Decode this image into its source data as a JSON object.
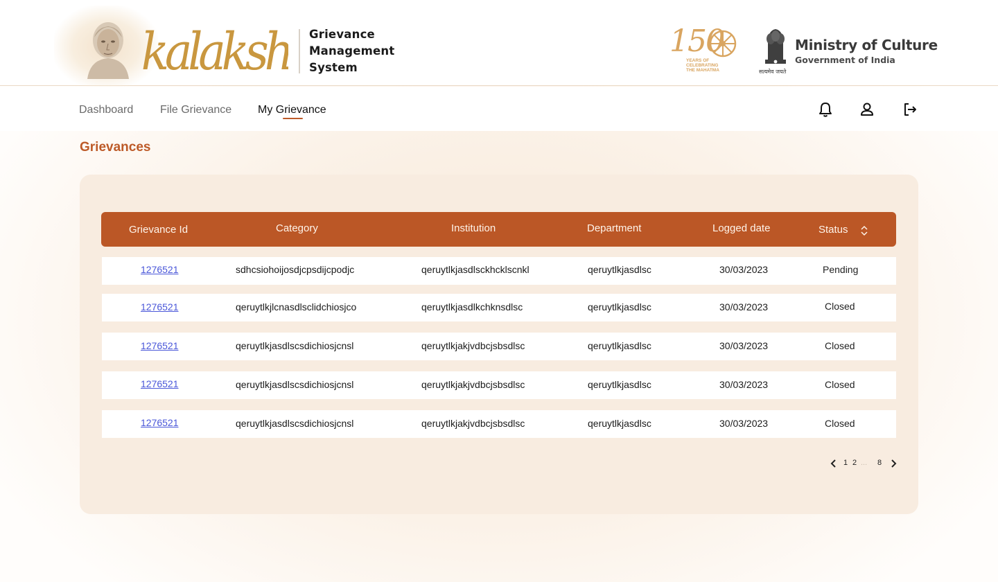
{
  "header": {
    "brand_script": "kalakshetra",
    "system_title_lines": [
      "Grievance",
      "Management",
      "System"
    ],
    "mahatma": {
      "number": "150",
      "subtitle_lines": [
        "YEARS OF",
        "CELEBRATING",
        "THE MAHATMA"
      ]
    },
    "emblem_motto": "सत्यमेव जयते",
    "ministry_name": "Ministry of Culture",
    "ministry_sub": "Government of India"
  },
  "nav": {
    "items": [
      {
        "label": "Dashboard",
        "active": false
      },
      {
        "label": "File Grievance",
        "active": false
      },
      {
        "label": "My Grievance",
        "active": true
      }
    ],
    "icons": [
      "bell-icon",
      "user-icon",
      "logout-icon"
    ]
  },
  "page": {
    "title": "Grievances"
  },
  "table": {
    "columns": [
      "Grievance Id",
      "Category",
      "Institution",
      "Department",
      "Logged date",
      "Status"
    ],
    "rows": [
      {
        "id": "1276521",
        "category": "sdhcsiohoijosdjcpsdijcpodjc",
        "institution": "qeruytlkjasdlsckhcklscnkl",
        "department": "qeruytlkjasdlsc",
        "date": "30/03/2023",
        "status": "Pending"
      },
      {
        "id": "1276521",
        "category": "qeruytlkjlcnasdlsclidchiosjco",
        "institution": "qeruytlkjasdlkchknsdlsc",
        "department": "qeruytlkjasdlsc",
        "date": "30/03/2023",
        "status": "Closed"
      },
      {
        "id": "1276521",
        "category": "qeruytlkjasdlscsdichiosjcnsl",
        "institution": "qeruytlkjakjvdbcjsbsdlsc",
        "department": "qeruytlkjasdlsc",
        "date": "30/03/2023",
        "status": "Closed"
      },
      {
        "id": "1276521",
        "category": "qeruytlkjasdlscsdichiosjcnsl",
        "institution": "qeruytlkjakjvdbcjsbsdlsc",
        "department": "qeruytlkjasdlsc",
        "date": "30/03/2023",
        "status": "Closed"
      },
      {
        "id": "1276521",
        "category": "qeruytlkjasdlscsdichiosjcnsl",
        "institution": "qeruytlkjakjvdbcjsbsdlsc",
        "department": "qeruytlkjasdlsc",
        "date": "30/03/2023",
        "status": "Closed"
      }
    ]
  },
  "pagination": {
    "pages": [
      "1",
      "2",
      "8"
    ],
    "ellipsis": "...",
    "current": "1"
  },
  "colors": {
    "accent": "#bb5726",
    "link": "#4a57d9",
    "card": "#f8ece0",
    "brand_gold": "#c9973f"
  }
}
